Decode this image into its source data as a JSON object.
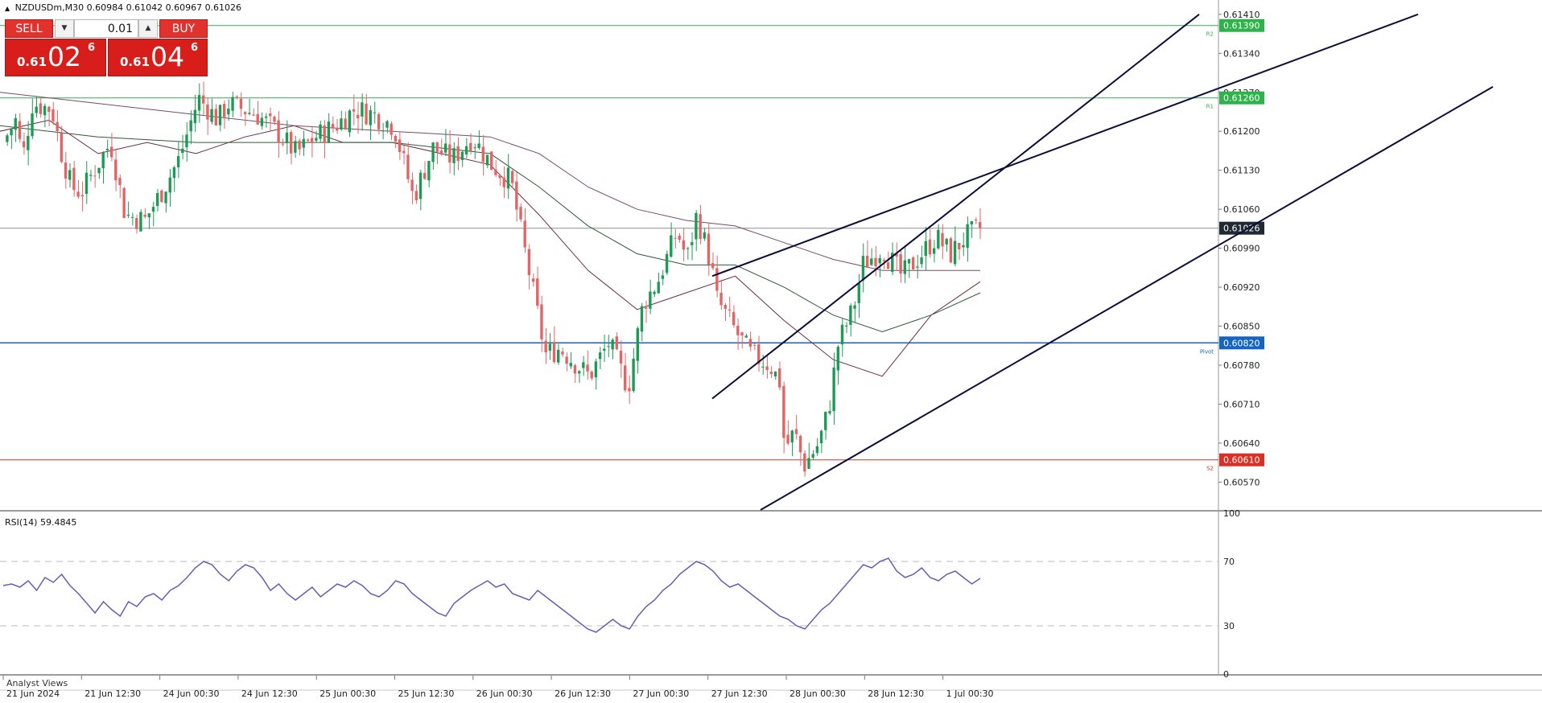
{
  "symbol_header": {
    "symbol": "NZDUSDm,M30",
    "ohlc": "0.60984 0.61042 0.60967 0.61026"
  },
  "trade_panel": {
    "sell_label": "SELL",
    "buy_label": "BUY",
    "lot_value": "0.01",
    "sell_price": {
      "prefix": "0.61",
      "big": "02",
      "sup": "6"
    },
    "buy_price": {
      "prefix": "0.61",
      "big": "04",
      "sup": "6"
    },
    "button_color": "#e2322e"
  },
  "indicator_header": {
    "label": "RSI(14) 59.4845"
  },
  "bottom_tab": {
    "label": "Analyst Views"
  },
  "colors": {
    "bull_candle": "#1d9a55",
    "bear_candle": "#e06666",
    "resistance": "#2db34a",
    "pivot": "#1565c0",
    "support": "#d93025",
    "current_price": "#1f2a33",
    "channel": "#0d0d3c",
    "rsi_line": "#6b5bb4"
  },
  "chart_data": {
    "type": "candlestick",
    "symbol": "NZDUSDm",
    "timeframe": "M30",
    "price_axis": {
      "ylim": [
        0.6052,
        0.6143
      ],
      "ticks": [
        "0.61410",
        "0.61340",
        "0.61270",
        "0.61200",
        "0.61130",
        "0.61060",
        "0.60990",
        "0.60920",
        "0.60850",
        "0.60780",
        "0.60710",
        "0.60640",
        "0.60570"
      ]
    },
    "time_axis": {
      "ticks": [
        "21 Jun 2024",
        "21 Jun 12:30",
        "24 Jun 00:30",
        "24 Jun 12:30",
        "25 Jun 00:30",
        "25 Jun 12:30",
        "26 Jun 00:30",
        "26 Jun 12:30",
        "27 Jun 00:30",
        "27 Jun 12:30",
        "28 Jun 00:30",
        "28 Jun 12:30",
        "1 Jul 00:30"
      ]
    },
    "levels": [
      {
        "name": "R2",
        "price": 0.6139,
        "label": "0.61390",
        "role": "resistance"
      },
      {
        "name": "R1",
        "price": 0.6126,
        "label": "0.61260",
        "role": "resistance"
      },
      {
        "name": "Pivot",
        "price": 0.6082,
        "label": "0.60820",
        "role": "pivot"
      },
      {
        "name": "S2",
        "price": 0.6061,
        "label": "0.60610",
        "role": "support"
      }
    ],
    "current_price": {
      "price": 0.61026,
      "label": "0.61026"
    },
    "channel": {
      "color": "#0d0d3c",
      "lines": [
        {
          "p1": [
            0.0,
            0.6072
          ],
          "p2": [
            1.0,
            0.6141
          ]
        },
        {
          "p1": [
            0.0,
            0.6094
          ],
          "p2": [
            1.0,
            0.6141
          ]
        },
        {
          "p1": [
            0.0,
            0.6052
          ],
          "p2": [
            1.0,
            0.6128
          ]
        }
      ]
    },
    "moving_averages": [
      {
        "color": "#6e2b3e",
        "points": [
          [
            0.0,
            0.612
          ],
          [
            0.05,
            0.6122
          ],
          [
            0.1,
            0.6116
          ],
          [
            0.15,
            0.6118
          ],
          [
            0.2,
            0.6116
          ],
          [
            0.25,
            0.6119
          ],
          [
            0.3,
            0.6121
          ],
          [
            0.35,
            0.6118
          ],
          [
            0.4,
            0.6118
          ],
          [
            0.45,
            0.6116
          ],
          [
            0.5,
            0.6114
          ],
          [
            0.55,
            0.6105
          ],
          [
            0.6,
            0.6095
          ],
          [
            0.65,
            0.6088
          ],
          [
            0.7,
            0.6091
          ],
          [
            0.75,
            0.6094
          ],
          [
            0.8,
            0.6086
          ],
          [
            0.85,
            0.6079
          ],
          [
            0.9,
            0.6076
          ],
          [
            0.95,
            0.6087
          ],
          [
            1.0,
            0.6093
          ]
        ]
      },
      {
        "color": "#2d5a3a",
        "points": [
          [
            0.0,
            0.6121
          ],
          [
            0.1,
            0.6119
          ],
          [
            0.2,
            0.6118
          ],
          [
            0.3,
            0.6118
          ],
          [
            0.4,
            0.6118
          ],
          [
            0.5,
            0.6116
          ],
          [
            0.55,
            0.611
          ],
          [
            0.6,
            0.6103
          ],
          [
            0.65,
            0.6098
          ],
          [
            0.7,
            0.6096
          ],
          [
            0.75,
            0.6096
          ],
          [
            0.8,
            0.6092
          ],
          [
            0.85,
            0.6087
          ],
          [
            0.9,
            0.6084
          ],
          [
            0.95,
            0.6087
          ],
          [
            1.0,
            0.6091
          ]
        ]
      },
      {
        "color": "#7a4a66",
        "points": [
          [
            0.0,
            0.6127
          ],
          [
            0.1,
            0.6125
          ],
          [
            0.2,
            0.6123
          ],
          [
            0.3,
            0.6121
          ],
          [
            0.4,
            0.612
          ],
          [
            0.5,
            0.6119
          ],
          [
            0.55,
            0.6116
          ],
          [
            0.6,
            0.611
          ],
          [
            0.65,
            0.6106
          ],
          [
            0.7,
            0.6104
          ],
          [
            0.75,
            0.6103
          ],
          [
            0.8,
            0.61
          ],
          [
            0.85,
            0.6097
          ],
          [
            0.9,
            0.6095
          ],
          [
            0.95,
            0.6095
          ],
          [
            1.0,
            0.6095
          ]
        ]
      }
    ],
    "candles": {
      "count": 234,
      "anchors": [
        [
          0.0,
          0.6118
        ],
        [
          0.013,
          0.6122
        ],
        [
          0.02,
          0.6115
        ],
        [
          0.03,
          0.6125
        ],
        [
          0.05,
          0.6124
        ],
        [
          0.06,
          0.6116
        ],
        [
          0.07,
          0.611
        ],
        [
          0.08,
          0.6109
        ],
        [
          0.09,
          0.6112
        ],
        [
          0.11,
          0.6118
        ],
        [
          0.125,
          0.6105
        ],
        [
          0.145,
          0.6104
        ],
        [
          0.165,
          0.611
        ],
        [
          0.18,
          0.6115
        ],
        [
          0.2,
          0.6126
        ],
        [
          0.22,
          0.6122
        ],
        [
          0.23,
          0.6125
        ],
        [
          0.26,
          0.6123
        ],
        [
          0.28,
          0.612
        ],
        [
          0.3,
          0.6116
        ],
        [
          0.32,
          0.6119
        ],
        [
          0.34,
          0.6121
        ],
        [
          0.36,
          0.6124
        ],
        [
          0.38,
          0.6123
        ],
        [
          0.4,
          0.6121
        ],
        [
          0.42,
          0.6108
        ],
        [
          0.44,
          0.6117
        ],
        [
          0.46,
          0.6115
        ],
        [
          0.48,
          0.6119
        ],
        [
          0.5,
          0.6114
        ],
        [
          0.52,
          0.6111
        ],
        [
          0.53,
          0.6102
        ],
        [
          0.545,
          0.6089
        ],
        [
          0.555,
          0.608
        ],
        [
          0.57,
          0.6081
        ],
        [
          0.6,
          0.6076
        ],
        [
          0.62,
          0.6082
        ],
        [
          0.64,
          0.6074
        ],
        [
          0.655,
          0.6089
        ],
        [
          0.67,
          0.6093
        ],
        [
          0.69,
          0.6102
        ],
        [
          0.7,
          0.6097
        ],
        [
          0.71,
          0.6105
        ],
        [
          0.725,
          0.6096
        ],
        [
          0.73,
          0.609
        ],
        [
          0.75,
          0.6084
        ],
        [
          0.765,
          0.608
        ],
        [
          0.785,
          0.6078
        ],
        [
          0.795,
          0.6075
        ],
        [
          0.8,
          0.6063
        ],
        [
          0.81,
          0.6066
        ],
        [
          0.82,
          0.606
        ],
        [
          0.835,
          0.6064
        ],
        [
          0.845,
          0.607
        ],
        [
          0.855,
          0.6082
        ],
        [
          0.87,
          0.6088
        ],
        [
          0.88,
          0.6096
        ],
        [
          0.9,
          0.6099
        ],
        [
          0.92,
          0.6094
        ],
        [
          0.94,
          0.6098
        ],
        [
          0.955,
          0.6101
        ],
        [
          0.97,
          0.6098
        ],
        [
          0.985,
          0.6101
        ],
        [
          1.0,
          0.61026
        ]
      ]
    }
  },
  "rsi": {
    "name": "RSI(14)",
    "value": 59.4845,
    "ylim": [
      0,
      100
    ],
    "ticks": [
      "100",
      "70",
      "30",
      "0"
    ],
    "levels": [
      70,
      30
    ],
    "values": [
      55,
      56,
      54,
      58,
      52,
      60,
      57,
      62,
      55,
      50,
      44,
      38,
      45,
      40,
      36,
      45,
      42,
      48,
      50,
      46,
      52,
      55,
      60,
      66,
      70,
      68,
      62,
      58,
      64,
      68,
      66,
      60,
      52,
      56,
      50,
      46,
      50,
      54,
      48,
      52,
      56,
      54,
      58,
      55,
      50,
      48,
      52,
      58,
      56,
      50,
      46,
      42,
      38,
      36,
      44,
      48,
      52,
      55,
      58,
      54,
      56,
      50,
      48,
      46,
      52,
      48,
      44,
      40,
      36,
      32,
      28,
      26,
      30,
      34,
      30,
      28,
      36,
      42,
      46,
      52,
      56,
      62,
      66,
      70,
      68,
      64,
      58,
      54,
      56,
      52,
      48,
      44,
      40,
      36,
      34,
      30,
      28,
      34,
      40,
      44,
      50,
      56,
      62,
      68,
      66,
      70,
      72,
      64,
      60,
      62,
      66,
      60,
      58,
      62,
      64,
      60,
      56,
      59.48
    ]
  }
}
